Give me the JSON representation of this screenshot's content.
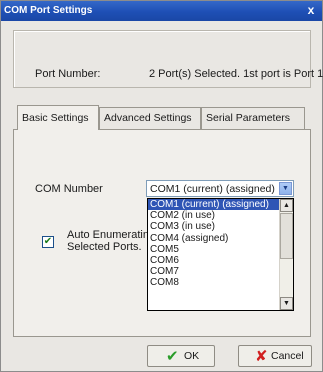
{
  "window": {
    "title": "COM Port Settings",
    "close_glyph": "x"
  },
  "port_info": {
    "label": "Port Number:",
    "value": "2 Port(s) Selected. 1st port is Port 1"
  },
  "tabs": [
    {
      "label": "Basic Settings",
      "active": true
    },
    {
      "label": "Advanced Settings",
      "active": false
    },
    {
      "label": "Serial Parameters",
      "active": false
    }
  ],
  "com_number": {
    "label": "COM Number",
    "selected": "COM1 (current) (assigned)",
    "options": [
      "COM1 (current) (assigned)",
      "COM2 (in use)",
      "COM3 (in use)",
      "COM4 (assigned)",
      "COM5",
      "COM6",
      "COM7",
      "COM8"
    ]
  },
  "auto_enumerate": {
    "checked": true,
    "label_line1": "Auto Enumerating",
    "label_line2": "Selected Ports."
  },
  "buttons": {
    "ok": "OK",
    "cancel": "Cancel"
  },
  "colors": {
    "title_bar": "#1e4fb5",
    "selection": "#2f55b5",
    "ok_icon": "#2a9d2a",
    "cancel_icon": "#d12020"
  }
}
